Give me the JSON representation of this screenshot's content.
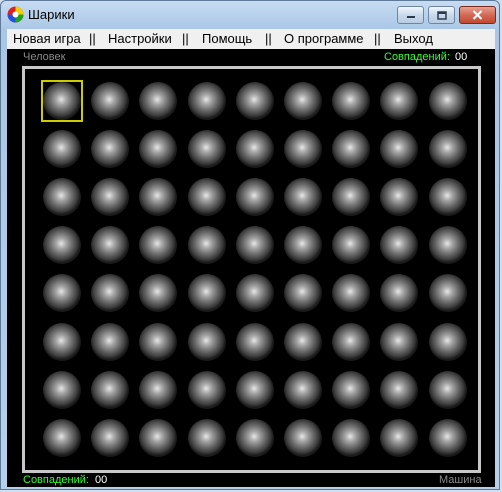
{
  "window": {
    "title": "Шарики"
  },
  "menu": {
    "items": [
      "Новая игра",
      "Настройки",
      "Помощь",
      "О программе",
      "Выход"
    ],
    "separator": "||"
  },
  "player_top": {
    "name": "Человек",
    "matches_label": "Совпадений:",
    "matches_value": "00"
  },
  "player_bottom": {
    "name": "Машина",
    "matches_label": "Совпадений:",
    "matches_value": "00"
  },
  "board": {
    "rows": 8,
    "cols": 9,
    "ball_color": "#808080",
    "cursor_color": "#cccc00",
    "selected": {
      "row": 1,
      "col": 1
    }
  }
}
